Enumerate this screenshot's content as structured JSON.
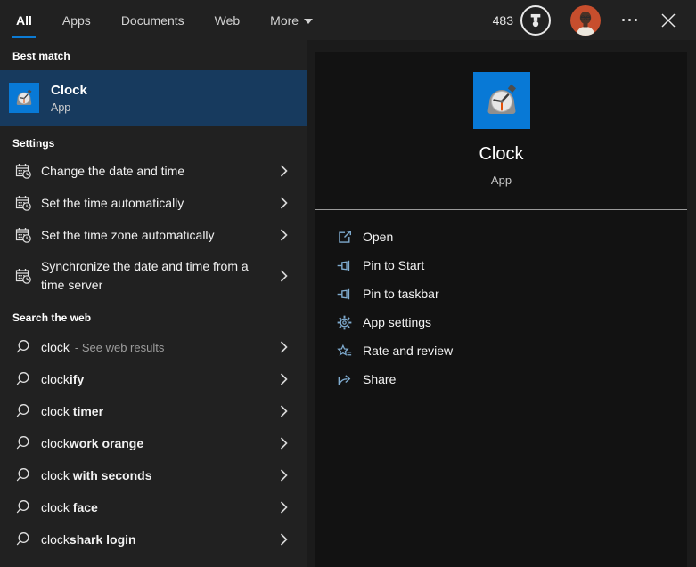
{
  "topbar": {
    "tabs": [
      {
        "label": "All",
        "active": true
      },
      {
        "label": "Apps",
        "active": false
      },
      {
        "label": "Documents",
        "active": false
      },
      {
        "label": "Web",
        "active": false
      },
      {
        "label": "More",
        "active": false,
        "has_dropdown": true
      }
    ],
    "rewards_count": "483"
  },
  "left": {
    "best_match": {
      "header": "Best match",
      "app": {
        "name": "Clock",
        "type": "App"
      }
    },
    "settings": {
      "header": "Settings",
      "items": [
        {
          "label": "Change the date and time"
        },
        {
          "label": "Set the time automatically"
        },
        {
          "label": "Set the time zone automatically"
        },
        {
          "label": "Synchronize the date and time from a time server"
        }
      ]
    },
    "web": {
      "header": "Search the web",
      "items": [
        {
          "query": "clock",
          "completion": "",
          "annotation": "- See web results"
        },
        {
          "query": "clock",
          "completion": "ify",
          "annotation": ""
        },
        {
          "query": "clock ",
          "completion": "timer",
          "annotation": ""
        },
        {
          "query": "clock",
          "completion": "work orange",
          "annotation": ""
        },
        {
          "query": "clock ",
          "completion": "with seconds",
          "annotation": ""
        },
        {
          "query": "clock ",
          "completion": "face",
          "annotation": ""
        },
        {
          "query": "clock",
          "completion": "shark login",
          "annotation": ""
        }
      ]
    }
  },
  "preview": {
    "app_name": "Clock",
    "app_type": "App",
    "actions": [
      {
        "label": "Open"
      },
      {
        "label": "Pin to Start"
      },
      {
        "label": "Pin to taskbar"
      },
      {
        "label": "App settings"
      },
      {
        "label": "Rate and review"
      },
      {
        "label": "Share"
      }
    ]
  },
  "colors": {
    "accent": "#0c7bd4",
    "best_match_highlight": "#173a5e",
    "action_icon": "#7fabcf",
    "clock_tile": "#0879d6",
    "second_hand": "#e2500a"
  }
}
